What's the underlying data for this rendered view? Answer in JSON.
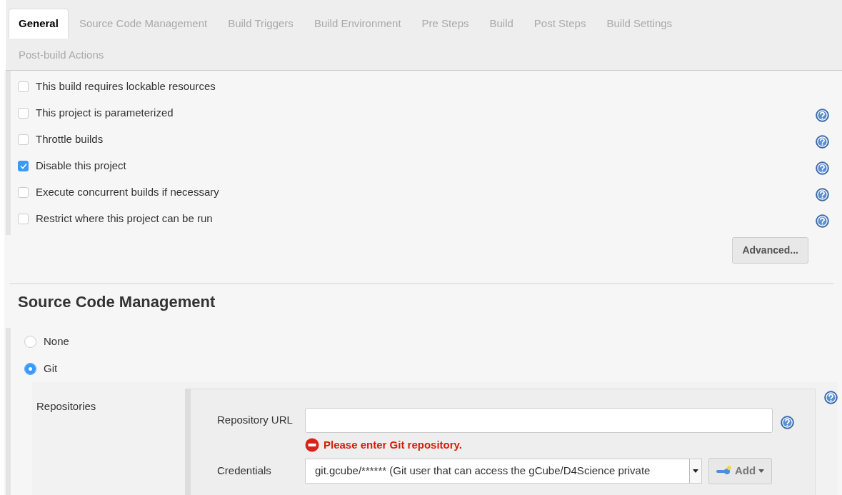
{
  "tabs": [
    {
      "label": "General",
      "selected": true
    },
    {
      "label": "Source Code Management",
      "selected": false
    },
    {
      "label": "Build Triggers",
      "selected": false
    },
    {
      "label": "Build Environment",
      "selected": false
    },
    {
      "label": "Pre Steps",
      "selected": false
    },
    {
      "label": "Build",
      "selected": false
    },
    {
      "label": "Post Steps",
      "selected": false
    },
    {
      "label": "Build Settings",
      "selected": false
    },
    {
      "label": "Post-build Actions",
      "selected": false
    }
  ],
  "general": {
    "options": [
      {
        "label": "This build requires lockable resources",
        "checked": false,
        "help": false
      },
      {
        "label": "This project is parameterized",
        "checked": false,
        "help": true
      },
      {
        "label": "Throttle builds",
        "checked": false,
        "help": true
      },
      {
        "label": "Disable this project",
        "checked": true,
        "help": true
      },
      {
        "label": "Execute concurrent builds if necessary",
        "checked": false,
        "help": true
      },
      {
        "label": "Restrict where this project can be run",
        "checked": false,
        "help": true
      }
    ],
    "advanced_button": "Advanced..."
  },
  "scm": {
    "title": "Source Code Management",
    "choices": [
      {
        "label": "None",
        "selected": false
      },
      {
        "label": "Git",
        "selected": true
      }
    ],
    "repositories_label": "Repositories",
    "repository_url": {
      "label": "Repository URL"
    },
    "error": "Please enter Git repository.",
    "credentials": {
      "label": "Credentials",
      "value": "git.gcube/****** (Git user that can access the gCube/D4Science private"
    },
    "add_button": "Add"
  }
}
